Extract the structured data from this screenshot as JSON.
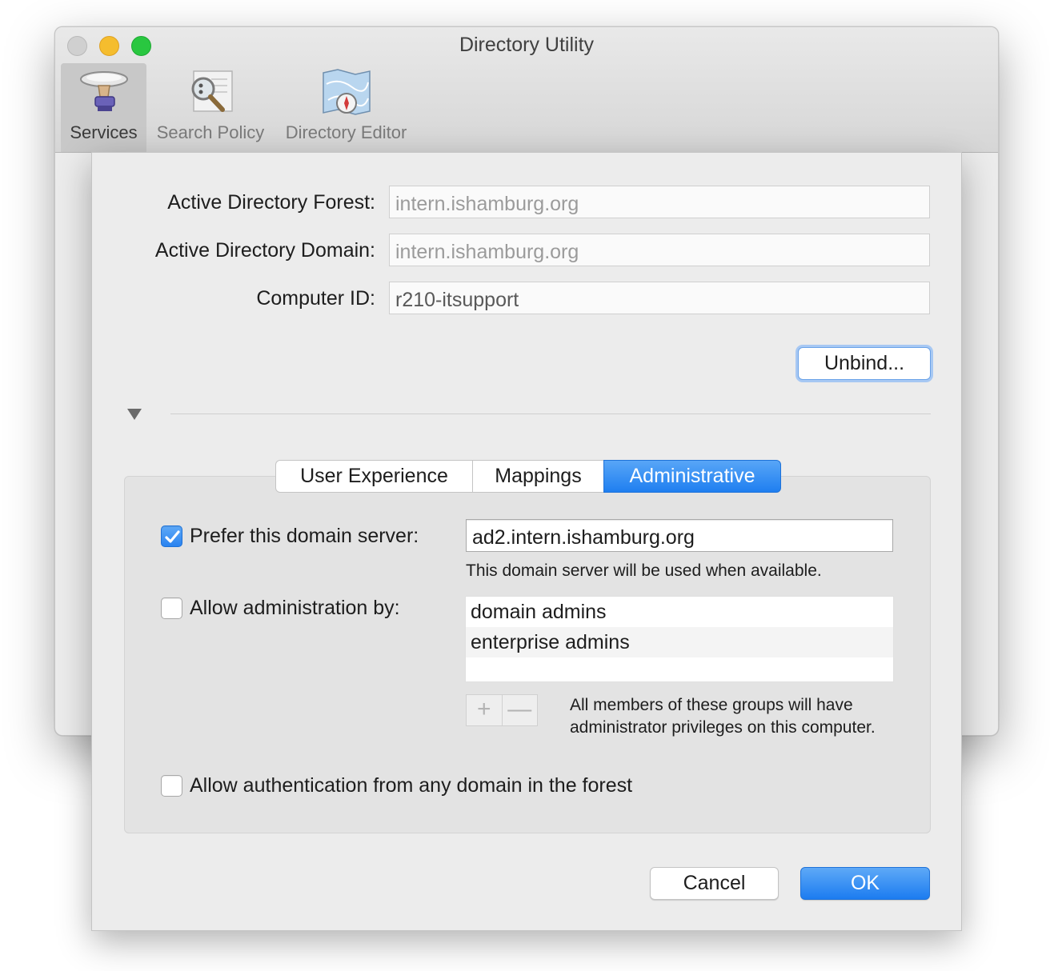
{
  "window": {
    "title": "Directory Utility"
  },
  "toolbar": {
    "items": [
      {
        "label": "Services",
        "icon": "services-icon",
        "selected": true
      },
      {
        "label": "Search Policy",
        "icon": "search-policy-icon",
        "selected": false
      },
      {
        "label": "Directory Editor",
        "icon": "directory-editor-icon",
        "selected": false
      }
    ]
  },
  "form": {
    "forest_label": "Active Directory Forest:",
    "forest_value": "intern.ishamburg.org",
    "domain_label": "Active Directory Domain:",
    "domain_value": "intern.ishamburg.org",
    "computer_id_label": "Computer ID:",
    "computer_id_value": "r210-itsupport"
  },
  "unbind_button": "Unbind...",
  "tabs": [
    {
      "label": "User Experience",
      "selected": false
    },
    {
      "label": "Mappings",
      "selected": false
    },
    {
      "label": "Administrative",
      "selected": true
    }
  ],
  "administrative": {
    "prefer_server": {
      "label": "Prefer this domain server:",
      "checked": true,
      "value": "ad2.intern.ishamburg.org",
      "hint": "This domain server will be used when available."
    },
    "allow_admin": {
      "label": "Allow administration by:",
      "checked": false,
      "groups": [
        "domain admins",
        "enterprise admins"
      ]
    },
    "add_symbol": "+",
    "remove_symbol": "—",
    "groups_hint": "All members of these groups will have administrator privileges on this computer.",
    "allow_auth": {
      "label": "Allow authentication from any domain in the forest",
      "checked": false
    }
  },
  "footer": {
    "cancel": "Cancel",
    "ok": "OK"
  },
  "colors": {
    "accent": "#2a83f0",
    "window_bg": "#ececec"
  }
}
